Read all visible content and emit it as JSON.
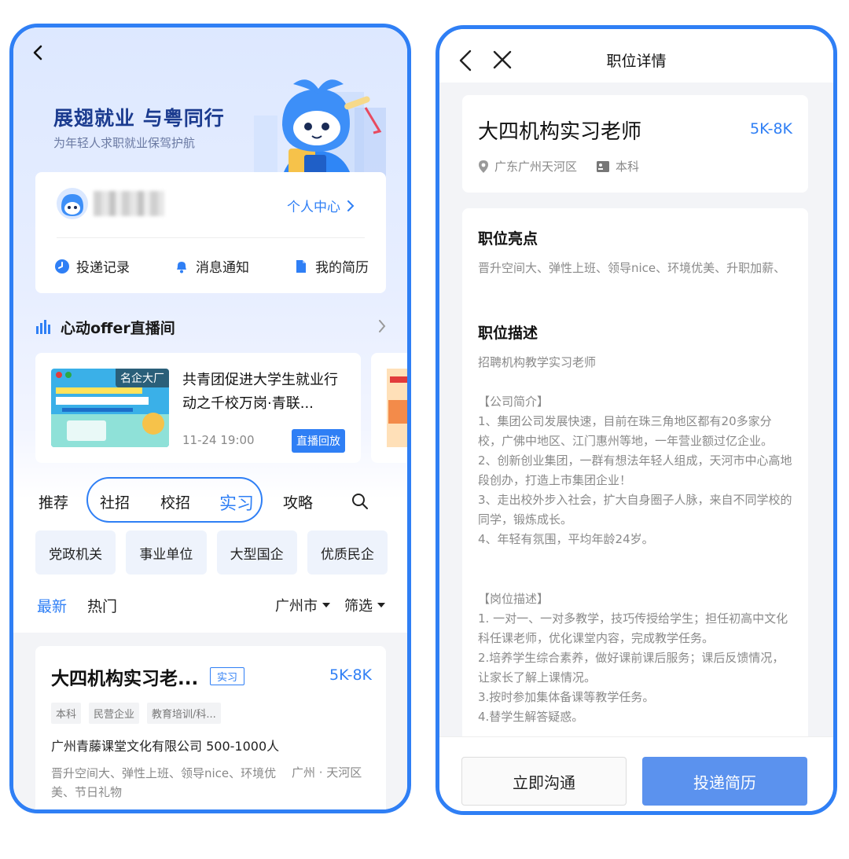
{
  "left": {
    "hero": {
      "title": "展翅就业 与粤同行",
      "subtitle": "为年轻人求职就业保驾护航"
    },
    "user_card": {
      "center_link": "个人中心",
      "quick_actions": [
        {
          "label": "投递记录",
          "icon": "clock-icon"
        },
        {
          "label": "消息通知",
          "icon": "bell-icon"
        },
        {
          "label": "我的简历",
          "icon": "document-icon"
        }
      ]
    },
    "live": {
      "section_title": "心动offer直播间",
      "card": {
        "badge": "名企大厂",
        "title": "共青团促进大学生就业行动之千校万岗·青联...",
        "time": "11-24 19:00",
        "button": "直播回放"
      }
    },
    "tabs": [
      "推荐",
      "社招",
      "校招",
      "实习",
      "攻略"
    ],
    "active_tab": "实习",
    "categories": [
      "党政机关",
      "事业单位",
      "大型国企",
      "优质民企"
    ],
    "sort": {
      "latest": "最新",
      "hot": "热门",
      "city": "广州市",
      "filter": "筛选"
    },
    "job": {
      "title": "大四机构实习老...",
      "tag": "实习",
      "salary": "5K-8K",
      "chips": [
        "本科",
        "民营企业",
        "教育培训/科..."
      ],
      "company": "广州青藤课堂文化有限公司 500-1000人",
      "desc": "晋升空间大、弹性上班、领导nice、环境优美、节日礼物",
      "location": "广州 · 天河区"
    }
  },
  "right": {
    "header_title": "职位详情",
    "job_title": "大四机构实习老师",
    "salary": "5K-8K",
    "location": "广东广州天河区",
    "education": "本科",
    "highlights_title": "职位亮点",
    "highlights": "晋升空间大、弹性上班、领导nice、环境优美、升职加薪、",
    "desc_title": "职位描述",
    "desc_intro": "招聘机构教学实习老师",
    "company_intro_title": "【公司简介】",
    "company_intro": "1、集团公司发展快速，目前在珠三角地区都有20多家分校，广佛中地区、江门惠州等地，一年营业额过亿企业。\n2、创新创业集团，一群有想法年轻人组成，天河市中心高地段创办，打造上市集团企业！\n3、走出校外步入社会，扩大自身圈子人脉，来自不同学校的同学，锻炼成长。\n4、年轻有氛围，平均年龄24岁。",
    "post_desc_title": "【岗位描述】",
    "post_desc": "1. 一对一、一对多教学，技巧传授给学生；担任初高中文化科任课老师，优化课堂内容，完成教学任务。\n2.培养学生综合素养，做好课前课后服务；课后反馈情况，让家长了解上课情况。\n3.按时参加集体备课等教学任务。\n4.替学生解答疑惑。",
    "btn_chat": "立即沟通",
    "btn_apply": "投递简历"
  },
  "colors": {
    "accent": "#2f7ff5",
    "apply_button": "#5b92ee",
    "hero_title": "#1b3b8f"
  }
}
